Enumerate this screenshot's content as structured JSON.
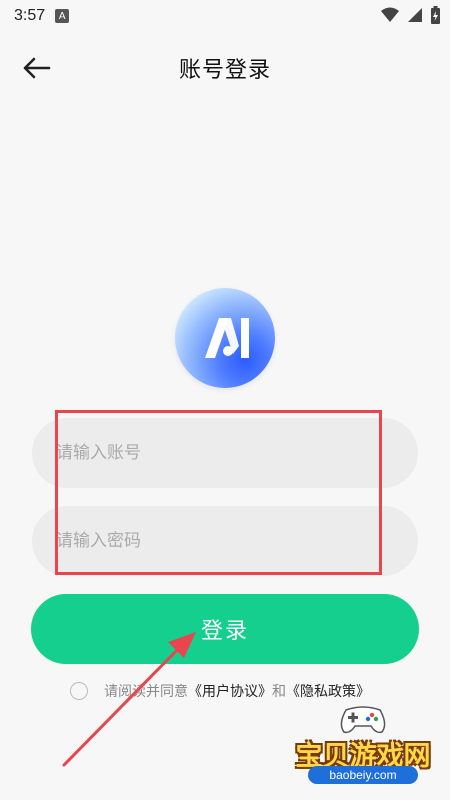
{
  "status_bar": {
    "time": "3:57",
    "notification_glyph": "A"
  },
  "header": {
    "title": "账号登录",
    "back_icon": "arrow-left-icon"
  },
  "logo": {
    "letters": "AI"
  },
  "form": {
    "account_placeholder": "请输入账号",
    "password_placeholder": "请输入密码",
    "login_label": "登录"
  },
  "agreement": {
    "prefix": "请阅读并同意",
    "user_agreement": "《用户协议》",
    "conjunction": "和",
    "privacy_policy": "《隐私政策》"
  },
  "watermark": {
    "title": "宝贝游戏网",
    "url": "baobeiy.com"
  },
  "colors": {
    "background": "#f7f7f7",
    "accent": "#14cf8e",
    "input_bg": "#ececec",
    "annotation_red": "#e8454f"
  }
}
